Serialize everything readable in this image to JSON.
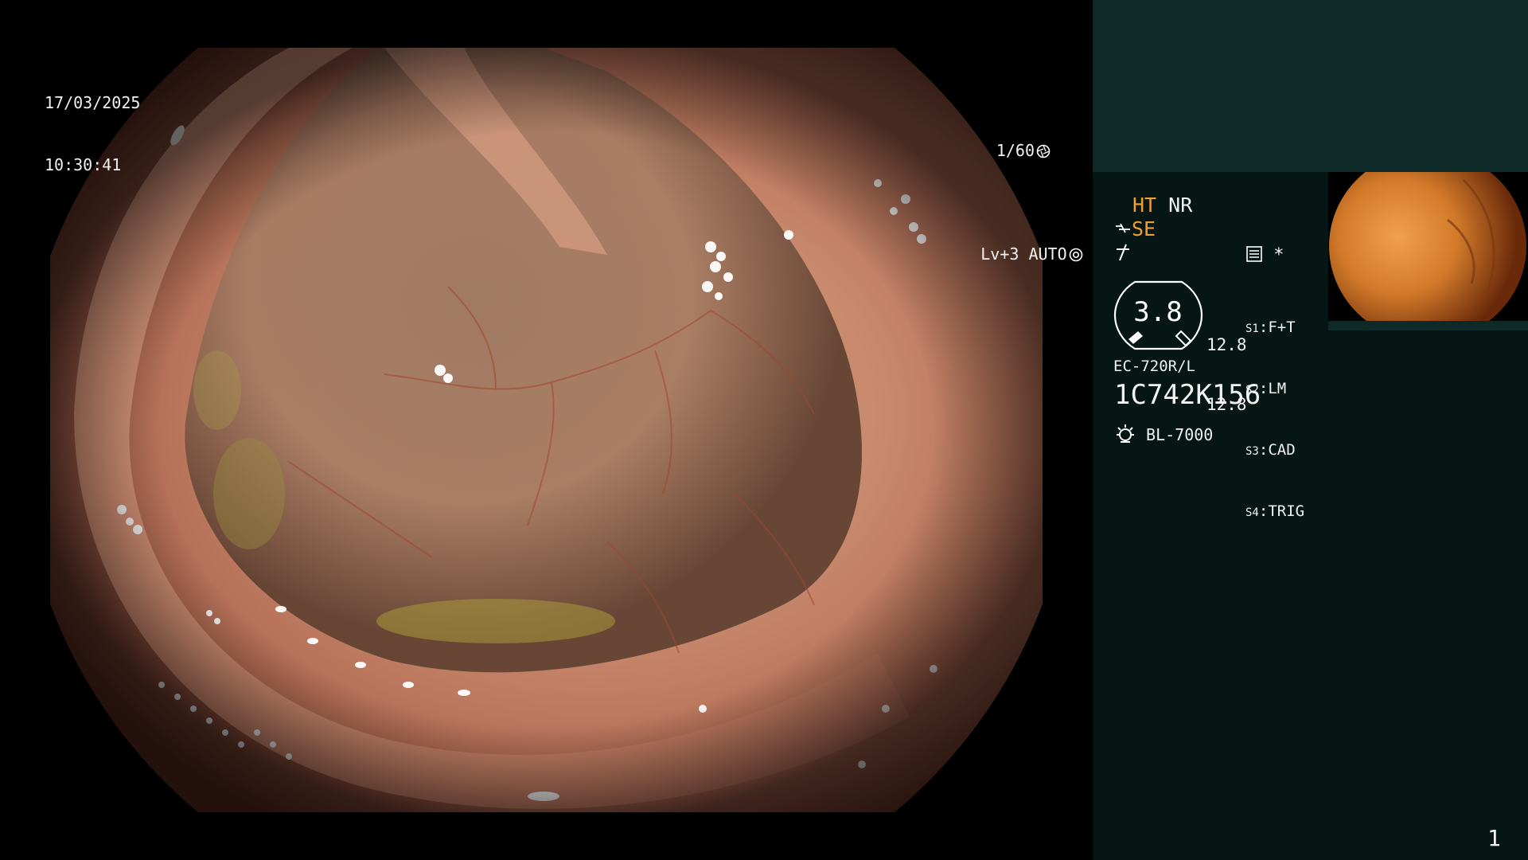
{
  "osd": {
    "date": "17/03/2025",
    "time": "10:30:41",
    "shutter": "1/60",
    "shutter_icon": "aperture-icon",
    "level": "Lv+3",
    "iris_mode": "AUTO",
    "iris_icon": "iris-icon"
  },
  "panel": {
    "ht_label": "HT",
    "nr_label": "NR",
    "se_label": "SE",
    "se_icon": "enhance-icon",
    "freeze_icon": "freeze-icon",
    "settings_icon": "settings-icon",
    "star_label": "*",
    "gauge_value": "3.8",
    "gauge_side_1": "12.8",
    "gauge_side_2": "12.8",
    "switches": [
      {
        "key": "S1",
        "value": "F+T"
      },
      {
        "key": "S2",
        "value": "LM"
      },
      {
        "key": "S3",
        "value": "CAD"
      },
      {
        "key": "S4",
        "value": "TRIG"
      }
    ],
    "scope_model": "EC-720R/L",
    "scope_serial": "1C742K156",
    "light_source": "BL-7000",
    "light_icon": "lamp-icon",
    "page_number": "1"
  },
  "colors": {
    "panel_bg": "#051615",
    "panel_top": "#0e2a28",
    "accent_orange": "#f0a030"
  }
}
